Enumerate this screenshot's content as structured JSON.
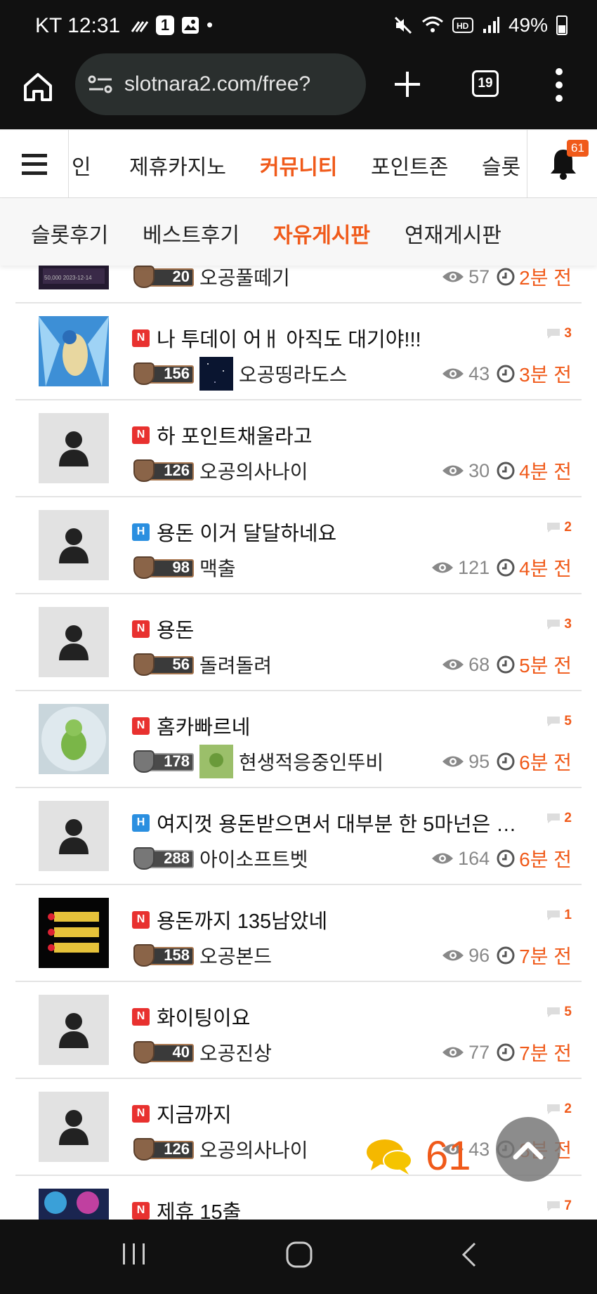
{
  "status_bar": {
    "carrier_time": "KT 12:31",
    "notif_badge": "1",
    "battery": "49%",
    "icons": [
      "signal-waves-icon",
      "one-badge-icon",
      "gallery-icon",
      "dot-icon",
      "mute-icon",
      "wifi-icon",
      "hd-icon",
      "signal-bars-icon",
      "battery-icon"
    ]
  },
  "browser": {
    "url": "slotnara2.com/free?",
    "tab_count": "19"
  },
  "site_nav": {
    "items": [
      {
        "label": "인",
        "active": false
      },
      {
        "label": "제휴카지노",
        "active": false
      },
      {
        "label": "커뮤니티",
        "active": true
      },
      {
        "label": "포인트존",
        "active": false
      },
      {
        "label": "슬롯",
        "active": false
      }
    ],
    "notification_count": "61"
  },
  "sub_tabs": [
    {
      "label": "슬롯후기",
      "active": false
    },
    {
      "label": "베스트후기",
      "active": false
    },
    {
      "label": "자유게시판",
      "active": true
    },
    {
      "label": "연재게시판",
      "active": false
    }
  ],
  "posts": [
    {
      "title": "",
      "tag": "",
      "comments": "",
      "level": "20",
      "nickname": "오공풀떼기",
      "views": "57",
      "time": "2분 전",
      "thumb": "image-dark",
      "has_user_img": false
    },
    {
      "title": "나 투데이 어ㅐ 아직도 대기야!!!",
      "tag": "N",
      "comments": "3",
      "level": "156",
      "nickname": "오공띵라도스",
      "views": "43",
      "time": "3분 전",
      "thumb": "image-blue",
      "has_user_img": true
    },
    {
      "title": "하 포인트채울라고",
      "tag": "N",
      "comments": "",
      "level": "126",
      "nickname": "오공의사나이",
      "views": "30",
      "time": "4분 전",
      "thumb": "user",
      "has_user_img": false
    },
    {
      "title": "용돈 이거 달달하네요",
      "tag": "H",
      "comments": "2",
      "level": "98",
      "nickname": "맥출",
      "views": "121",
      "time": "4분 전",
      "thumb": "user",
      "has_user_img": false
    },
    {
      "title": "용돈",
      "tag": "N",
      "comments": "3",
      "level": "56",
      "nickname": "돌려돌려",
      "views": "68",
      "time": "5분 전",
      "thumb": "user",
      "has_user_img": false
    },
    {
      "title": "홈카빠르네",
      "tag": "N",
      "comments": "5",
      "level": "178",
      "nickname": "현생적응중인뚜비",
      "views": "95",
      "time": "6분 전",
      "thumb": "image-green",
      "has_user_img": true
    },
    {
      "title": "여지껏 용돈받으면서 대부분 한 5마넌은 …",
      "tag": "H",
      "comments": "2",
      "level": "288",
      "nickname": "아이소프트벳",
      "views": "164",
      "time": "6분 전",
      "thumb": "user",
      "has_user_img": false
    },
    {
      "title": "용돈까지 135남았네",
      "tag": "N",
      "comments": "1",
      "level": "158",
      "nickname": "오공본드",
      "views": "96",
      "time": "7분 전",
      "thumb": "image-yellow",
      "has_user_img": false
    },
    {
      "title": "화이팅이요",
      "tag": "N",
      "comments": "5",
      "level": "40",
      "nickname": "오공진상",
      "views": "77",
      "time": "7분 전",
      "thumb": "user",
      "has_user_img": false
    },
    {
      "title": "지금까지",
      "tag": "N",
      "comments": "2",
      "level": "126",
      "nickname": "오공의사나이",
      "views": "43",
      "time": "8분 전",
      "thumb": "user",
      "has_user_img": false
    },
    {
      "title": "제휴 15출",
      "tag": "N",
      "comments": "7",
      "level": "",
      "nickname": "",
      "views": "",
      "time": "",
      "thumb": "image-purple",
      "has_user_img": false
    }
  ],
  "chat_fab": {
    "count": "61"
  },
  "colors": {
    "accent": "#f05a1a",
    "new_tag": "#e8312f",
    "hot_tag": "#2a8fe0"
  }
}
